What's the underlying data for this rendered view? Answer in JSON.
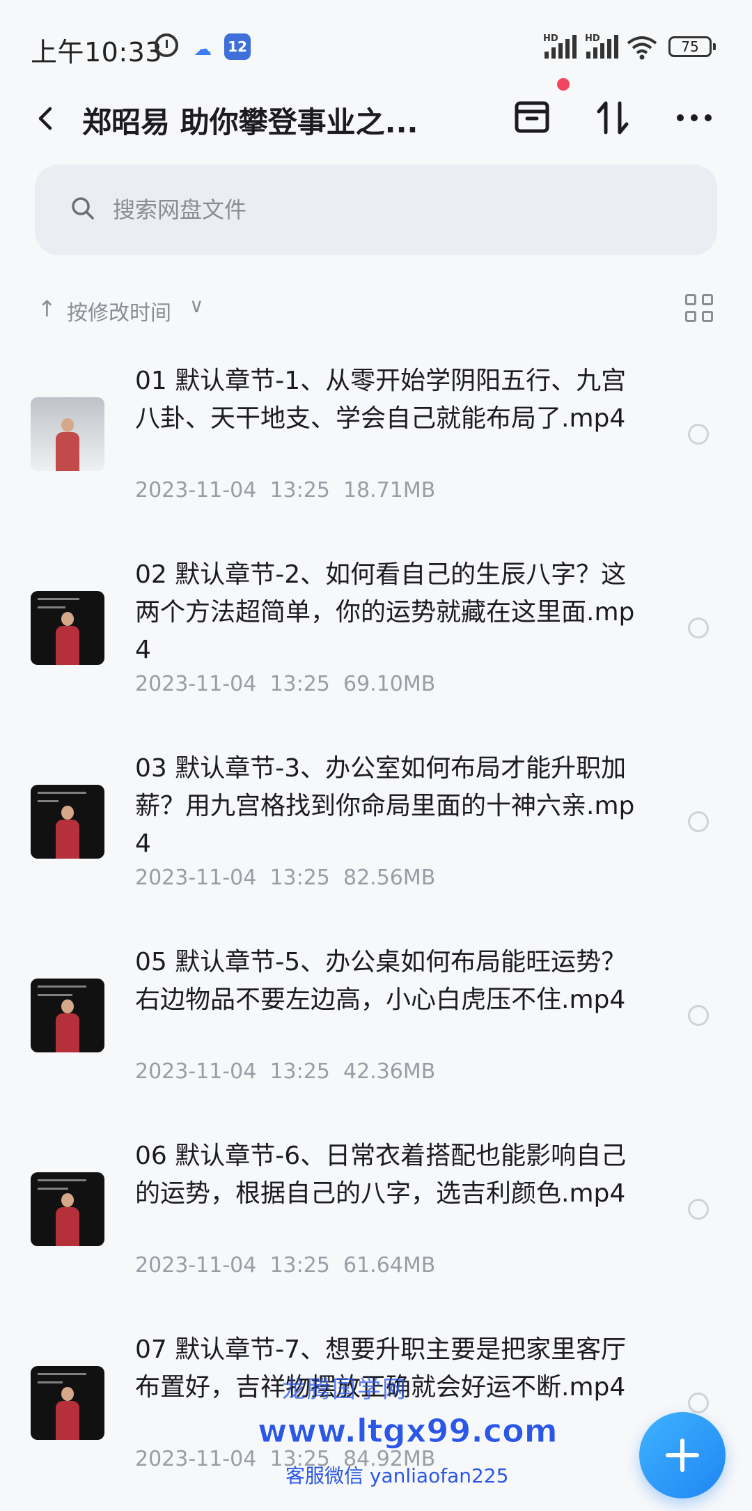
{
  "status_bar": {
    "time": "上午10:33",
    "hd1": "HD",
    "hd2": "HD",
    "battery": "75",
    "app_badge": "12"
  },
  "header": {
    "title": "郑昭易 助你攀登事业之..."
  },
  "search": {
    "placeholder": "搜索网盘文件"
  },
  "sort": {
    "label": "按修改时间"
  },
  "files": [
    {
      "name": "01 默认章节-1、从零开始学阴阳五行、九宫八卦、天干地支、学会自己就能布局了.mp4",
      "date": "2023-11-04",
      "time": "13:25",
      "size": "18.71MB"
    },
    {
      "name": "02 默认章节-2、如何看自己的生辰八字？这两个方法超简单，你的运势就藏在这里面.mp4",
      "date": "2023-11-04",
      "time": "13:25",
      "size": "69.10MB"
    },
    {
      "name": "03 默认章节-3、办公室如何布局才能升职加薪？用九宫格找到你命局里面的十神六亲.mp4",
      "date": "2023-11-04",
      "time": "13:25",
      "size": "82.56MB"
    },
    {
      "name": "05 默认章节-5、办公桌如何布局能旺运势？右边物品不要左边高，小心白虎压不住.mp4",
      "date": "2023-11-04",
      "time": "13:25",
      "size": "42.36MB"
    },
    {
      "name": "06 默认章节-6、日常衣着搭配也能影响自己的运势，根据自己的八字，选吉利颜色.mp4",
      "date": "2023-11-04",
      "time": "13:25",
      "size": "61.64MB"
    },
    {
      "name": "07 默认章节-7、想要升职主要是把家里客厅布置好，吉祥物摆放正确就会好运不断.mp4",
      "date": "2023-11-04",
      "time": "13:25",
      "size": "84.92MB"
    }
  ],
  "watermark": {
    "line1": "龙腾国学网",
    "line2": "www.ltgx99.com",
    "line3": "客服微信 yanliaofan225"
  },
  "colors": {
    "accent": "#2b8cf5",
    "notification_dot": "#f2455f",
    "background": "#f7f8fa"
  }
}
